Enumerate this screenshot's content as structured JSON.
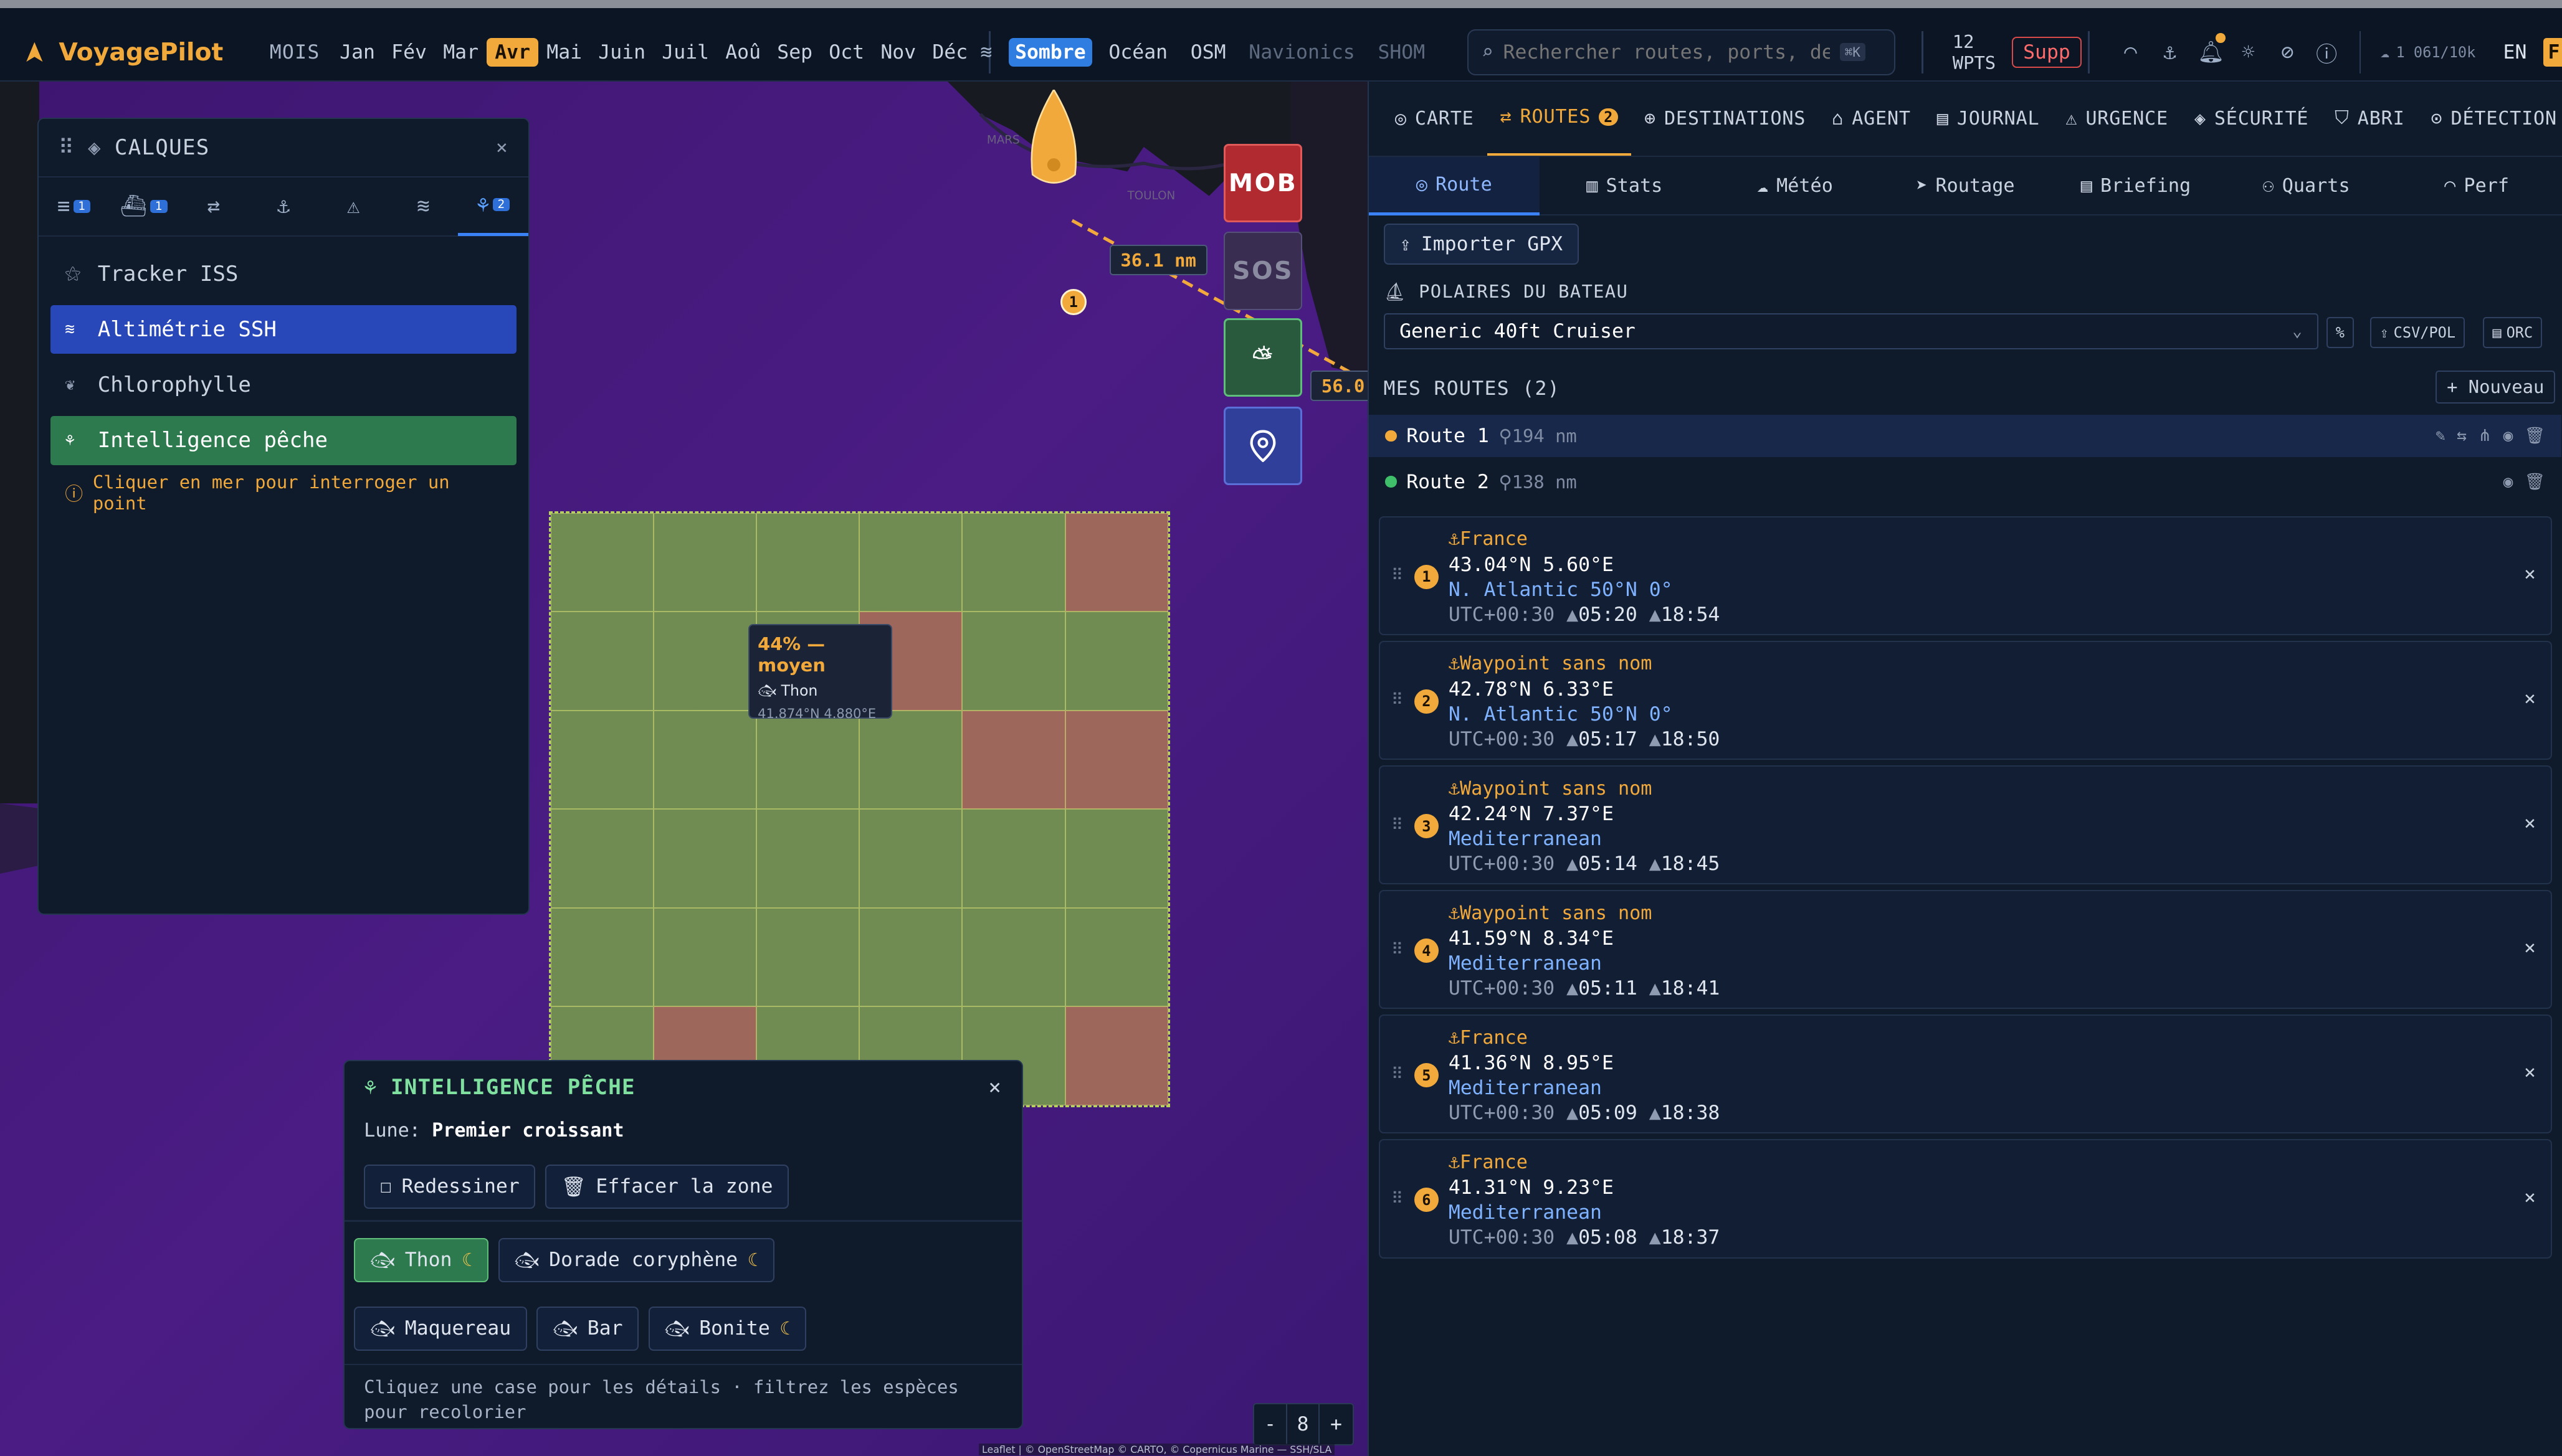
{
  "app": {
    "name": "VoyagePilot"
  },
  "months": {
    "label": "MOIS",
    "items": [
      "Jan",
      "Fév",
      "Mar",
      "Avr",
      "Mai",
      "Juin",
      "Juil",
      "Aoû",
      "Sep",
      "Oct",
      "Nov",
      "Déc"
    ],
    "active": "Avr"
  },
  "themes": {
    "items": [
      "Sombre",
      "Océan",
      "OSM",
      "Navionics",
      "SHOM"
    ],
    "active": "Sombre"
  },
  "search": {
    "placeholder": "Rechercher routes, ports, destin",
    "shortcut": "⌘K"
  },
  "waypoints": {
    "count": "12",
    "label": "WPTS",
    "delete": "Supp"
  },
  "quota": "1 061/10k",
  "lang": "EN",
  "lang_flag": "F",
  "map": {
    "distance_1": "36.1 nm",
    "distance_2": "56.0",
    "waypoint_1": "1",
    "tooltip": {
      "title": "44% — moyen",
      "species": "Thon",
      "coords": "41.874°N 4.880°E"
    },
    "place_labels": [
      "MARS",
      "TOULON"
    ],
    "zoom_level": "8",
    "zoom_out": "-",
    "zoom_in": "+",
    "attribution": "Leaflet | © OpenStreetMap © CARTO, © Copernicus Marine — SSH/SLA",
    "buttons": {
      "mob": "MOB",
      "sos": "SOS"
    }
  },
  "layers_panel": {
    "title": "CALQUES",
    "close": "×",
    "tabs": [
      {
        "icon": "wind-icon",
        "badge": "1"
      },
      {
        "icon": "ship-icon",
        "badge": "1"
      },
      {
        "icon": "route-icon",
        "badge": ""
      },
      {
        "icon": "anchor-icon",
        "badge": ""
      },
      {
        "icon": "warning-icon",
        "badge": ""
      },
      {
        "icon": "waves-icon",
        "badge": ""
      },
      {
        "icon": "satellite-icon",
        "badge": "2"
      }
    ],
    "items": [
      {
        "label": "Tracker ISS",
        "state": "off"
      },
      {
        "label": "Altimétrie SSH",
        "state": "blue"
      },
      {
        "label": "Chlorophylle",
        "state": "off"
      },
      {
        "label": "Intelligence pêche",
        "state": "green"
      }
    ],
    "hint": "Cliquer en mer pour interroger un point"
  },
  "fishing_panel": {
    "title": "INTELLIGENCE PÊCHE",
    "close": "×",
    "moon_label": "Lune:",
    "moon_value": "Premier croissant",
    "redraw": "Redessiner",
    "clear": "Effacer la zone",
    "species": [
      {
        "label": "Thon",
        "active": true,
        "moon": true
      },
      {
        "label": "Dorade coryphène",
        "active": false,
        "moon": true
      },
      {
        "label": "Maquereau",
        "active": false,
        "moon": false
      },
      {
        "label": "Bar",
        "active": false,
        "moon": false
      },
      {
        "label": "Bonite",
        "active": false,
        "moon": true
      }
    ],
    "note": "Cliquez une case pour les détails · filtrez les espèces pour recolorier"
  },
  "panel": {
    "tabs": [
      {
        "label": "CARTE",
        "active": false,
        "badge": ""
      },
      {
        "label": "ROUTES",
        "active": true,
        "badge": "2"
      },
      {
        "label": "DESTINATIONS",
        "active": false,
        "badge": ""
      },
      {
        "label": "AGENT",
        "active": false,
        "badge": ""
      },
      {
        "label": "JOURNAL",
        "active": false,
        "badge": ""
      },
      {
        "label": "URGENCE",
        "active": false,
        "badge": ""
      },
      {
        "label": "SÉCURITÉ",
        "active": false,
        "badge": ""
      },
      {
        "label": "ABRI",
        "active": false,
        "badge": ""
      },
      {
        "label": "DÉTECTION",
        "active": false,
        "badge": ""
      }
    ],
    "subtabs": [
      {
        "label": "Route",
        "active": true
      },
      {
        "label": "Stats",
        "active": false
      },
      {
        "label": "Météo",
        "active": false
      },
      {
        "label": "Routage",
        "active": false
      },
      {
        "label": "Briefing",
        "active": false
      },
      {
        "label": "Quarts",
        "active": false
      },
      {
        "label": "Perf",
        "active": false
      }
    ],
    "import_gpx": "Importer GPX",
    "polars_title": "POLAIRES DU BATEAU",
    "polar_selected": "Generic 40ft Cruiser",
    "polar_buttons": [
      "%",
      "CSV/POL",
      "ORC"
    ],
    "my_routes": "MES ROUTES (2)",
    "new_route": "+ Nouveau",
    "routes": [
      {
        "name": "Route 1",
        "distance": "194 nm",
        "color": "#f2a93b",
        "active": true
      },
      {
        "name": "Route 2",
        "distance": "138 nm",
        "color": "#3fbf6a",
        "active": false
      }
    ],
    "waypoints": [
      {
        "n": "1",
        "name": "France",
        "coords": "43.04°N 5.60°E",
        "zone": "N. Atlantic 50°N 0°",
        "tz": "UTC+00:30",
        "rise": "05:20",
        "set": "18:54"
      },
      {
        "n": "2",
        "name": "Waypoint sans nom",
        "coords": "42.78°N 6.33°E",
        "zone": "N. Atlantic 50°N 0°",
        "tz": "UTC+00:30",
        "rise": "05:17",
        "set": "18:50"
      },
      {
        "n": "3",
        "name": "Waypoint sans nom",
        "coords": "42.24°N 7.37°E",
        "zone": "Mediterranean",
        "tz": "UTC+00:30",
        "rise": "05:14",
        "set": "18:45"
      },
      {
        "n": "4",
        "name": "Waypoint sans nom",
        "coords": "41.59°N 8.34°E",
        "zone": "Mediterranean",
        "tz": "UTC+00:30",
        "rise": "05:11",
        "set": "18:41"
      },
      {
        "n": "5",
        "name": "France",
        "coords": "41.36°N 8.95°E",
        "zone": "Mediterranean",
        "tz": "UTC+00:30",
        "rise": "05:09",
        "set": "18:38"
      },
      {
        "n": "6",
        "name": "France",
        "coords": "41.31°N 9.23°E",
        "zone": "Mediterranean",
        "tz": "UTC+00:30",
        "rise": "05:08",
        "set": "18:37"
      }
    ]
  },
  "colors": {
    "accent": "#f2a93b",
    "blue": "#3b82f6",
    "green": "#2d7a4e",
    "danger": "#b02a30"
  }
}
